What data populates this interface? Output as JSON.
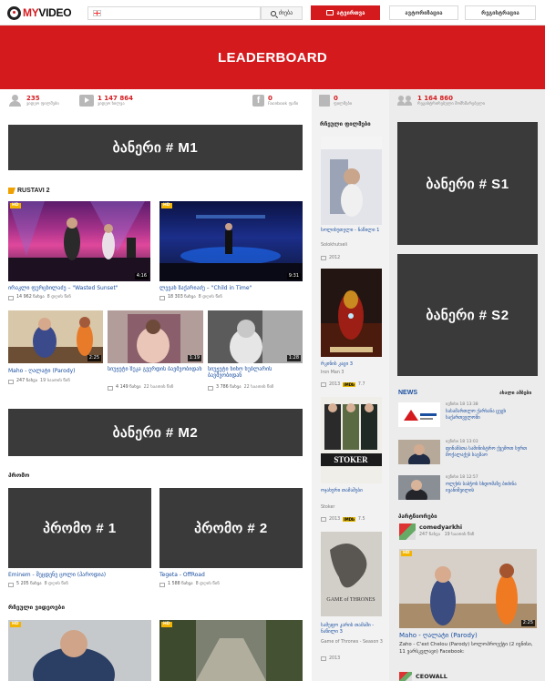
{
  "topnav": {
    "logo_my": "MY",
    "logo_video": "VIDEO",
    "search_placeholder": "",
    "search_button": "ძიება",
    "upload_button": "ატვირთვა",
    "login_button": "ავტორიზაცია",
    "register_button": "რეგისტრაცია"
  },
  "leaderboard": "LEADERBOARD",
  "stats": {
    "users_count": "235",
    "users_label": "ვიდეო ფილმები",
    "videos_count": "1 147 864",
    "videos_label": "ვიდეო ხილვა",
    "fb_count": "0",
    "fb_label": "Facebook ფანი",
    "films_count": "0",
    "films_label": "ფილმები",
    "online_count": "1 164 860",
    "online_label": "რეგისტრირებული მომხმარებელი"
  },
  "banners": {
    "m1": "ბანერი # M1",
    "m2": "ბანერი # M2",
    "s1": "ბანერი # S1",
    "s2": "ბანერი # S2",
    "promo1": "პრომო # 1",
    "promo2": "პრომო # 2"
  },
  "sections": {
    "rustavi": "RUSTAVI 2",
    "promo": "პრომო",
    "popular_videos": "რჩეული ვიდეოები",
    "popular_films": "რჩეული ფილმები",
    "partners": "პარტნიორები"
  },
  "rustavi_videos": [
    {
      "title": "ირაკლი ფურცხილაძე – \"Wasted Sunset\"",
      "views": "14 962 ნახვა",
      "added": "8 დღის წინ",
      "duration": "4:16"
    },
    {
      "title": "ლევან ზაქარიაძე – \"Child in Time\"",
      "views": "18 303 ნახვა",
      "added": "8 დღის წინ",
      "duration": "9:31"
    },
    {
      "title": "Maho - ღალატი (Parody)",
      "views": "247 ნახვა",
      "added": "19 საათის წინ",
      "duration": "2:25"
    },
    {
      "title": "სიუჟეტი ზუკა გვერდის ბავშვობიდან",
      "views": "4 149 ნახვა",
      "added": "22 საათის წინ",
      "duration": "1:19"
    },
    {
      "title": "სიუჟეტი ნინო ხუბლარის ბავშვობიდან",
      "views": "3 786 ნახვა",
      "added": "22 საათის წინ",
      "duration": "1:28"
    }
  ],
  "promo_videos": [
    {
      "title": "Eminem - შეცდენე ცოლი (პაროდია)",
      "views": "5 205 ნახვა",
      "added": "8 დღის წინ"
    },
    {
      "title": "Tegeta - OffRoad",
      "views": "1 588 ნახვა",
      "added": "8 დღის წინ"
    }
  ],
  "films": [
    {
      "title": "სოლიხუთელი - ნაწილი 1",
      "sub": "Solokhutseli",
      "year": "2012",
      "imdb": ""
    },
    {
      "title": "რკინის კაცი 3",
      "sub": "Iron Man 3",
      "year": "2013",
      "imdb": "7.7"
    },
    {
      "title": "ოჯახური თამაშები",
      "sub": "Stoker",
      "year": "2013",
      "imdb": "7.5"
    },
    {
      "title": "სამეფო კარის თამაში - ნაწილი 3",
      "sub": "Game of Thrones - Season 3",
      "year": "2013",
      "imdb": ""
    }
  ],
  "news": {
    "logo": "NEWS",
    "all": "ახალი ამბები",
    "items": [
      {
        "time": "ივნისი 18 13:38",
        "text": "სასამართლო ქარხანა ცეცხ საქართველოში"
      },
      {
        "time": "ივნისი 18 13:03",
        "text": "ფინანსთა სამინისტრო ქვემოთ სურთ მოქალაქეს საგზაო"
      },
      {
        "time": "ივნისი 18 12:57",
        "text": "ოლქის საბჭოს სხდომაზე ბიძინა ივანიშვილის"
      }
    ]
  },
  "partner": {
    "name": "comedyarkhi",
    "views": "247 ნახვა",
    "added": "19 საათის წინ",
    "video_title": "Maho - ღალატი (Parody)",
    "video_desc": "Zaho - C'est Chelou (Parody) სოლოპროექტი (2 ივნისი, 11 ვარსკვლავი) Facebook:",
    "duration": "2:25",
    "bottom_name": "CEOWALL"
  },
  "colors": {
    "brand_red": "#d51a1e",
    "banner_gray": "#3a3a3a",
    "link_blue": "#1a4fa0",
    "hd_badge": "#f2b400"
  }
}
